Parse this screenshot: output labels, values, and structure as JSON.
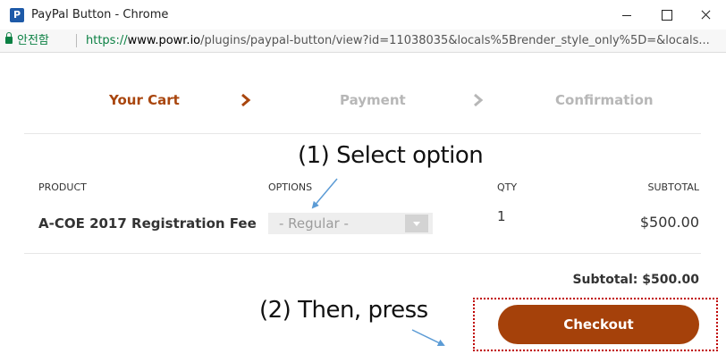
{
  "window": {
    "title": "PayPal Button - Chrome",
    "app_icon": "P"
  },
  "address_bar": {
    "secure_label": "안전함",
    "url_scheme": "https://",
    "url_host": "www.powr.io",
    "url_path": "/plugins/paypal-button/view?id=11038035&locals%5Brender_style_only%5D=&locals..."
  },
  "steps": [
    {
      "label": "Your Cart",
      "state": "active"
    },
    {
      "label": "Payment",
      "state": "inactive"
    },
    {
      "label": "Confirmation",
      "state": "inactive"
    }
  ],
  "table": {
    "headers": {
      "product": "PRODUCT",
      "options": "OPTIONS",
      "qty": "QTY",
      "subtotal": "SUBTOTAL"
    },
    "rows": [
      {
        "product": "A-COE 2017 Registration Fee",
        "option": "- Regular -",
        "qty": "1",
        "subtotal": "$500.00"
      }
    ]
  },
  "cart_subtotal": "Subtotal: $500.00",
  "checkout_label": "Checkout",
  "annotations": {
    "select_hint": "(1) Select option",
    "press_hint": "(2) Then, press"
  },
  "colors": {
    "accent": "#a5410a",
    "step_active": "#a9460e",
    "step_inactive": "#b7b7b7",
    "highlight_border": "#c00000",
    "arrow": "#5b9bd5",
    "secure": "#0b8043"
  },
  "icons": [
    "app-icon",
    "lock-icon",
    "chevron-right-icon",
    "dropdown-caret-icon",
    "minimize-icon",
    "maximize-icon",
    "close-icon"
  ]
}
